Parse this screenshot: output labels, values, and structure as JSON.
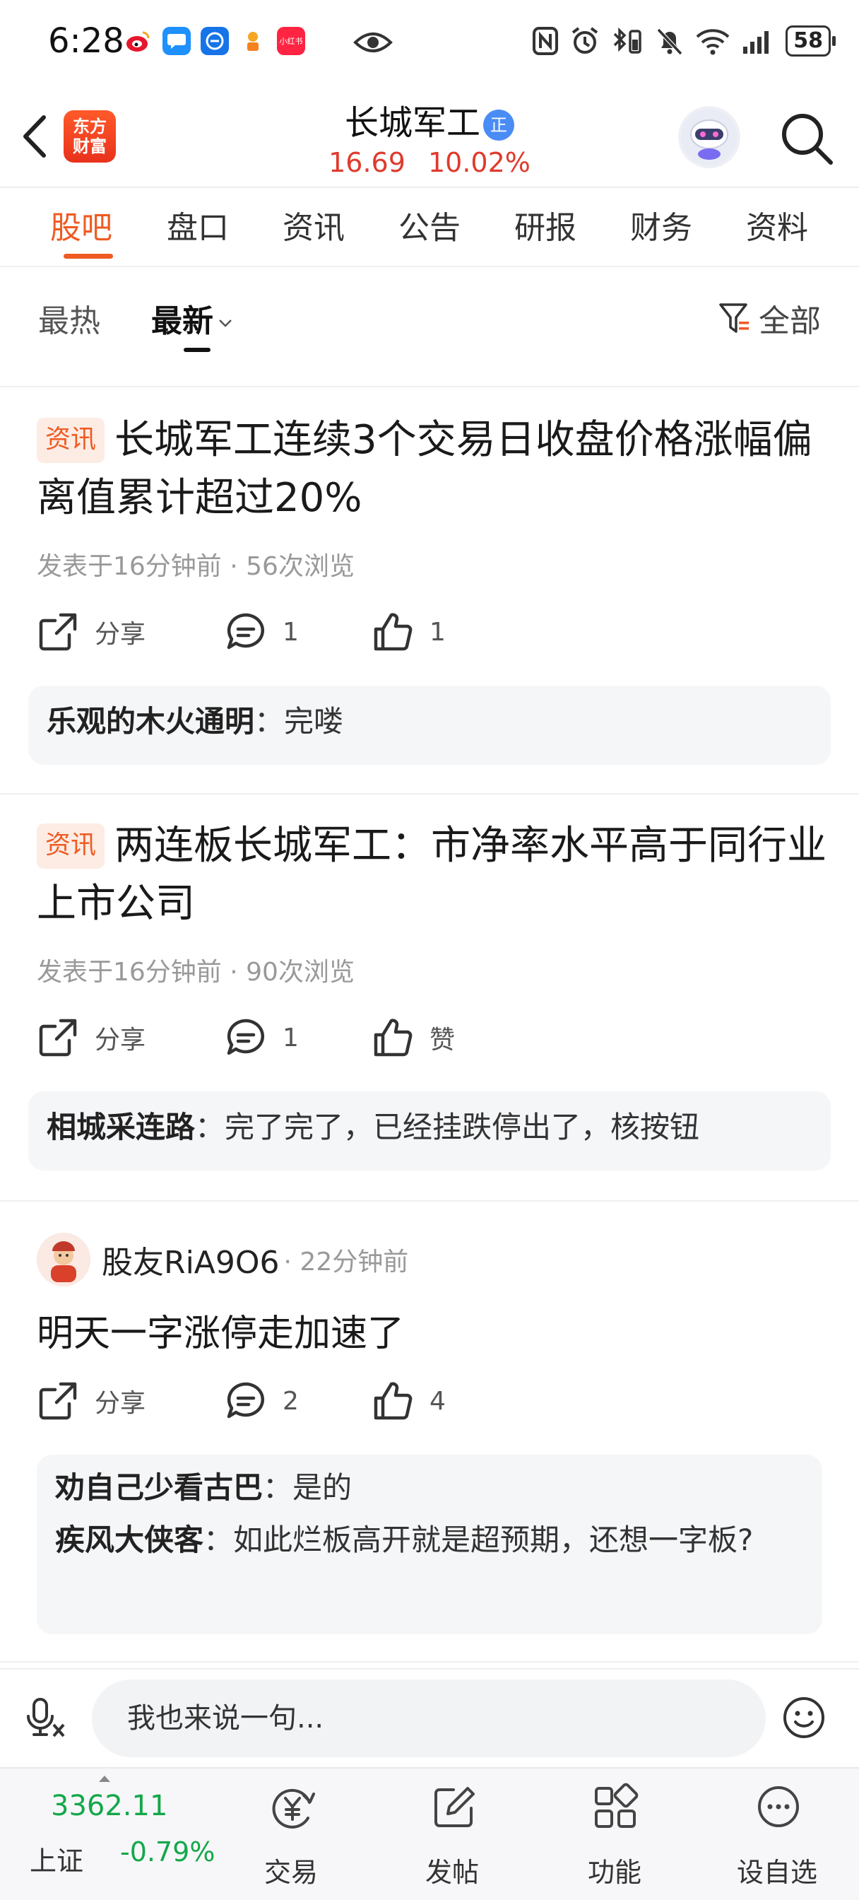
{
  "status_bar": {
    "time": "6:28",
    "battery": "58",
    "app_icons": [
      {
        "name": "weibo",
        "color": "#e6162d",
        "text": "微"
      },
      {
        "name": "message",
        "color": "#1e90ff",
        "text": "…"
      },
      {
        "name": "browser",
        "color": "#1674e8",
        "text": "e"
      },
      {
        "name": "app4",
        "color": "#f6a623",
        "text": "♥"
      },
      {
        "name": "xiaohongshu",
        "color": "#ff2442",
        "text": "小红书"
      }
    ]
  },
  "header": {
    "logo_line1": "东方",
    "logo_line2": "财富",
    "stock_name": "长城军工",
    "badge": "正",
    "price": "16.69",
    "change_pct": "10.02%"
  },
  "tabs": [
    "股吧",
    "盘口",
    "资讯",
    "公告",
    "研报",
    "财务",
    "资料"
  ],
  "sort": {
    "hot": "最热",
    "new": "最新",
    "filter": "全部"
  },
  "posts": [
    {
      "tag": "资讯",
      "title": "长城军工连续3个交易日收盘价格涨幅偏离值累计超过20%",
      "meta": "发表于16分钟前 · 56次浏览",
      "share": "分享",
      "comments": "1",
      "likes": "1",
      "replies": [
        {
          "user": "乐观的木火通明",
          "text": "：完喽"
        }
      ]
    },
    {
      "tag": "资讯",
      "title": "两连板长城军工：市净率水平高于同行业上市公司",
      "meta": "发表于16分钟前 · 90次浏览",
      "share": "分享",
      "comments": "1",
      "likes": "赞",
      "replies": [
        {
          "user": "相城采连路",
          "text": "：完了完了，已经挂跌停出了，核按钮"
        }
      ]
    },
    {
      "user": "股友RiA9O6",
      "time": "· 22分钟前",
      "body": "明天一字涨停走加速了",
      "share": "分享",
      "comments": "2",
      "likes": "4",
      "replies": [
        {
          "user": "劝自己少看古巴",
          "text": "：是的"
        },
        {
          "user": "疾风大侠客",
          "text": "：如此烂板高开就是超预期，还想一字板?"
        }
      ]
    }
  ],
  "comment_bar": {
    "placeholder": "我也来说一句..."
  },
  "bottom_nav": {
    "index_value": "3362.11",
    "index_name": "上证",
    "index_change": "-0.79%",
    "items": [
      "交易",
      "发帖",
      "功能",
      "设自选"
    ]
  },
  "colors": {
    "accent": "#ef5b22",
    "price_up": "#e03a2c",
    "price_down": "#14a84a"
  }
}
